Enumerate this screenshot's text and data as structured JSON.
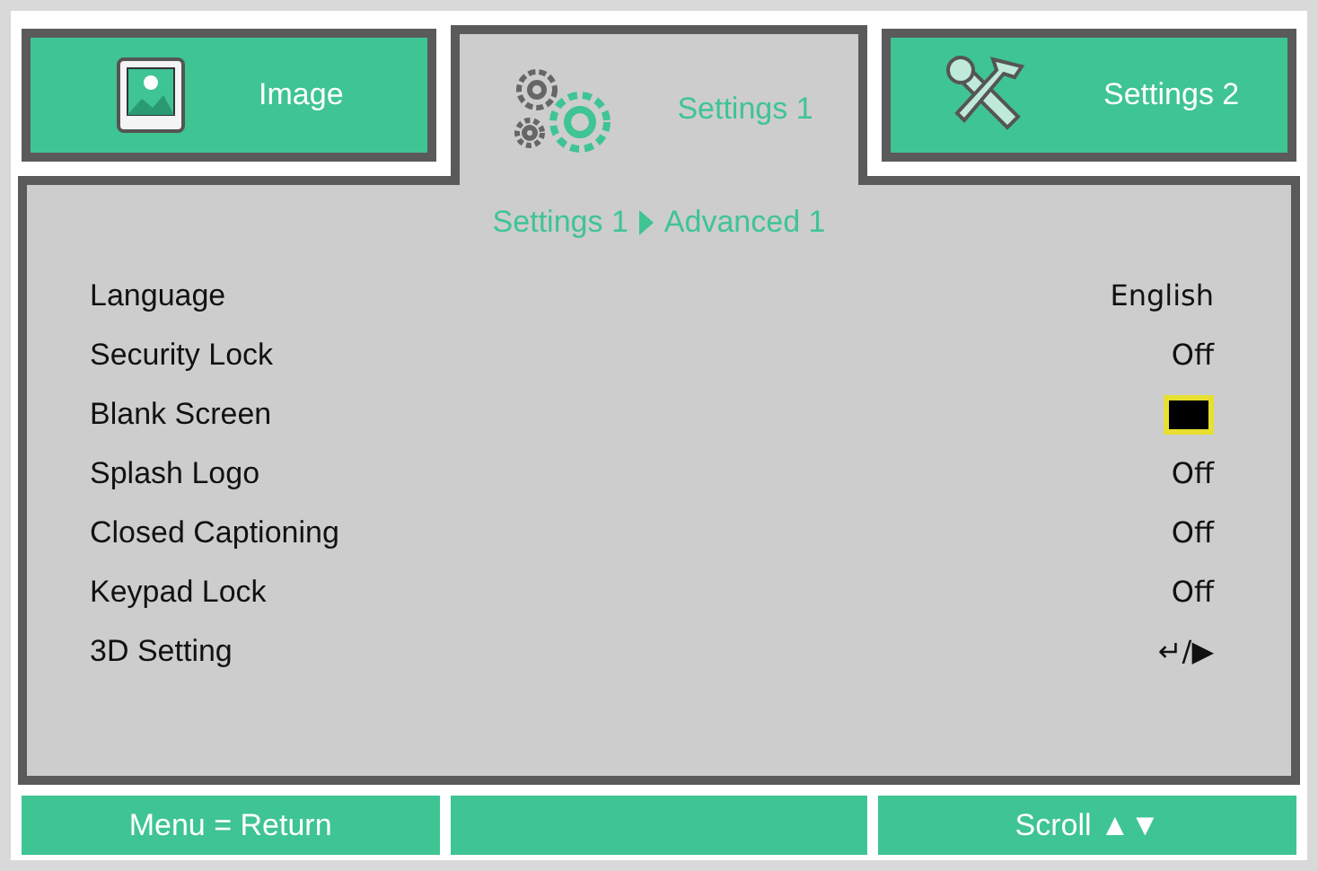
{
  "tabs": [
    {
      "label": "Image",
      "kind": "picture",
      "selected": false
    },
    {
      "label": "Settings 1",
      "kind": "gears",
      "selected": true
    },
    {
      "label": "Settings 2",
      "kind": "tools",
      "selected": false
    }
  ],
  "breadcrumb": {
    "parent": "Settings 1",
    "current": "Advanced 1"
  },
  "rows": [
    {
      "label": "Language",
      "kind": "text",
      "value": "English"
    },
    {
      "label": "Security Lock",
      "kind": "text",
      "value": "Off"
    },
    {
      "label": "Blank Screen",
      "kind": "swatch"
    },
    {
      "label": "Splash Logo",
      "kind": "text",
      "value": "Off"
    },
    {
      "label": "Closed Captioning",
      "kind": "text",
      "value": "Off"
    },
    {
      "label": "Keypad Lock",
      "kind": "text",
      "value": "Off"
    },
    {
      "label": "3D Setting",
      "kind": "text",
      "value": "↵/▶"
    }
  ],
  "footer": [
    {
      "kind": "hint",
      "text": "Menu = Return"
    },
    {
      "kind": "blank"
    },
    {
      "kind": "hint",
      "text": "Scroll ▲▼"
    }
  ]
}
